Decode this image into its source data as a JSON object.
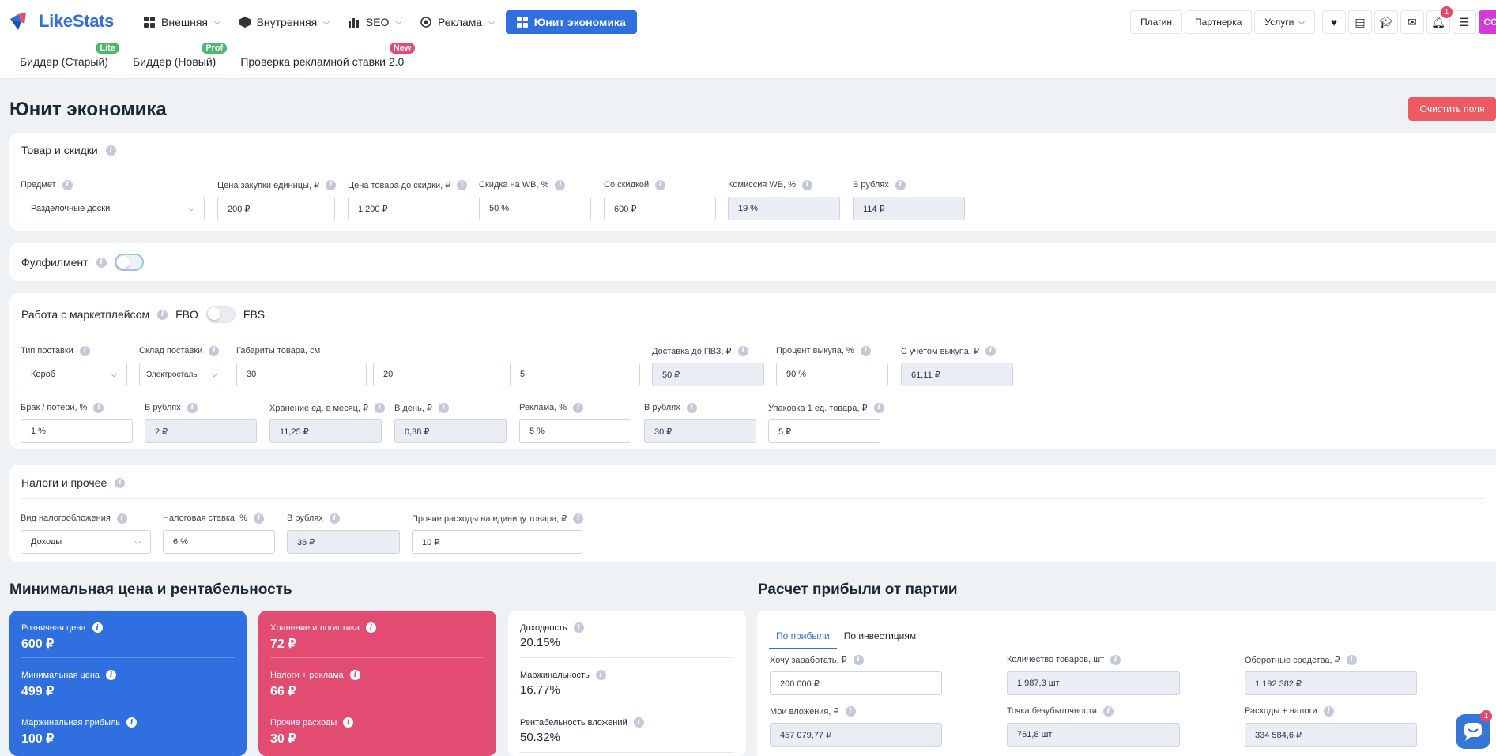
{
  "brand": {
    "name": "LikeStats"
  },
  "nav": [
    {
      "label": "Внешняя",
      "icon": "grid-icon"
    },
    {
      "label": "Внутренняя",
      "icon": "cube-icon"
    },
    {
      "label": "SEO",
      "icon": "bar-chart-icon"
    },
    {
      "label": "Реклама",
      "icon": "target-icon"
    },
    {
      "label": "Юнит экономика",
      "icon": "grid-icon"
    }
  ],
  "subnav": [
    {
      "label": "Биддер (Старый)",
      "badge": "Lite",
      "badge_color": "#4cb86a"
    },
    {
      "label": "Биддер (Новый)",
      "badge": "Prof",
      "badge_color": "#4cb86a"
    },
    {
      "label": "Проверка рекламной ставки 2.0",
      "badge": "New",
      "badge_color": "#e24c73"
    }
  ],
  "header_buttons": {
    "plugin": "Плагин",
    "partner": "Партнерка",
    "services": "Услуги"
  },
  "icons": [
    "heart-icon",
    "document-icon",
    "graduation-cap-icon",
    "mail-icon",
    "bell-icon",
    "menu-icon"
  ],
  "notifications_count": "1",
  "avatar_initials": "CC",
  "page": {
    "title": "Юнит экономика",
    "clear_button": "Очистить поля"
  },
  "goods": {
    "title": "Товар и скидки",
    "subject": {
      "label": "Предмет",
      "value": "Разделочные доски"
    },
    "purchase_price": {
      "label": "Цена закупки единицы, ₽",
      "value": "200 ₽"
    },
    "price_before": {
      "label": "Цена товара до скидки, ₽",
      "value": "1 200 ₽"
    },
    "wb_discount": {
      "label": "Скидка на WB, %",
      "value": "50 %"
    },
    "with_discount": {
      "label": "Со скидкой",
      "value": "600 ₽"
    },
    "wb_commission": {
      "label": "Комиссия WB, %",
      "value": "19 %"
    },
    "in_rubles": {
      "label": "В рублях",
      "value": "114 ₽"
    }
  },
  "fulfillment": {
    "title": "Фулфилмент"
  },
  "marketplace": {
    "title": "Работа с маркетплейсом",
    "mode_left": "FBO",
    "mode_right": "FBS",
    "supply_type": {
      "label": "Тип поставки",
      "value": "Короб"
    },
    "warehouse": {
      "label": "Склад поставки",
      "value": "Электросталь"
    },
    "dimensions": {
      "label": "Габариты товара, см",
      "a": "30",
      "b": "20",
      "c": "5"
    },
    "delivery": {
      "label": "Доставка до ПВЗ, ₽",
      "value": "50 ₽"
    },
    "buyout_pct": {
      "label": "Процент выкупа, %",
      "value": "90 %"
    },
    "with_buyout": {
      "label": "С учетом выкупа, ₽",
      "value": "61,11 ₽"
    },
    "defect": {
      "label": "Брак / потери, %",
      "value": "1 %"
    },
    "defect_rub": {
      "label": "В рублях",
      "value": "2 ₽"
    },
    "storage_month": {
      "label": "Хранение ед. в месяц, ₽",
      "value": "11,25 ₽"
    },
    "storage_day": {
      "label": "В день, ₽",
      "value": "0,38 ₽"
    },
    "ads": {
      "label": "Реклама, %",
      "value": "5 %"
    },
    "ads_rub": {
      "label": "В рублях",
      "value": "30 ₽"
    },
    "packaging": {
      "label": "Упаковка 1 ед. товара, ₽",
      "value": "5 ₽"
    }
  },
  "taxes": {
    "title": "Налоги и прочее",
    "tax_type": {
      "label": "Вид налогообложения",
      "value": "Доходы"
    },
    "tax_rate": {
      "label": "Налоговая ставка, %",
      "value": "6 %"
    },
    "tax_rub": {
      "label": "В рублях",
      "value": "36 ₽"
    },
    "other": {
      "label": "Прочие расходы на единицу товара, ₽",
      "value": "10 ₽"
    }
  },
  "min_price": {
    "title": "Минимальная цена и рентабельность",
    "blue": [
      {
        "label": "Розничная цена",
        "value": "600 ₽"
      },
      {
        "label": "Минимальная цена",
        "value": "499 ₽"
      },
      {
        "label": "Маржинальная прибыль",
        "value": "100 ₽"
      }
    ],
    "pink": [
      {
        "label": "Хранение и логистика",
        "value": "72 ₽"
      },
      {
        "label": "Налоги + реклама",
        "value": "66 ₽"
      },
      {
        "label": "Прочие расходы",
        "value": "30 ₽"
      }
    ],
    "white": [
      {
        "label": "Доходность",
        "value": "20.15%"
      },
      {
        "label": "Маржинальность",
        "value": "16.77%"
      },
      {
        "label": "Рентабельность вложений",
        "value": "50.32%"
      }
    ]
  },
  "profit": {
    "title": "Расчет прибыли от партии",
    "tabs": [
      "По прибыли",
      "По инвестициям"
    ],
    "want_earn": {
      "label": "Хочу заработать, ₽",
      "value": "200 000 ₽"
    },
    "goods_count": {
      "label": "Количество товаров, шт",
      "value": "1 987,3 шт"
    },
    "working_capital": {
      "label": "Оборотные средства, ₽",
      "value": "1 192 382 ₽"
    },
    "my_investment": {
      "label": "Мои вложения, ₽",
      "value": "457 079,77 ₽"
    },
    "breakeven": {
      "label": "Точка безубыточности",
      "value": "761,8 шт"
    },
    "expenses": {
      "label": "Расходы + налоги",
      "value": "334 584,6 ₽"
    }
  },
  "chat_badge": "1"
}
